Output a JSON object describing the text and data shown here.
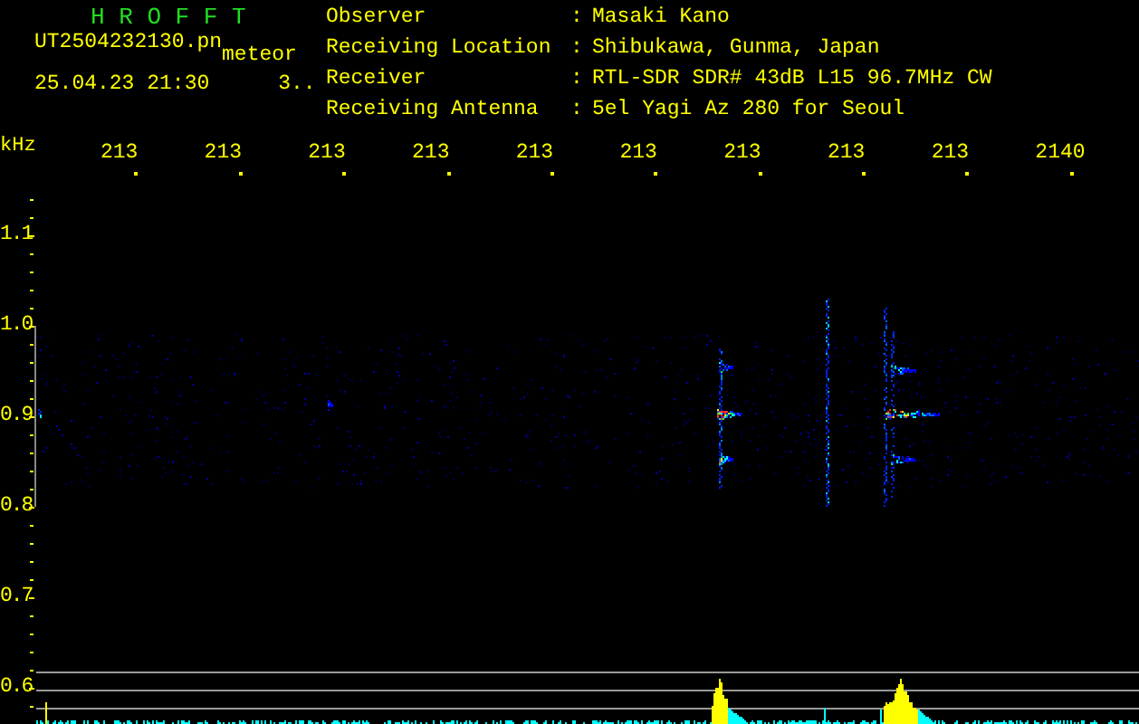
{
  "header": {
    "title": "H R O F F T",
    "filename": "UT2504232130.pn",
    "tag": "meteor",
    "datetime": "25.04.23 21:30",
    "count": "3..",
    "info": [
      {
        "label": "Observer",
        "separator": ":",
        "value": "Masaki Kano"
      },
      {
        "label": "Receiving Location",
        "separator": ":",
        "value": "Shibukawa, Gunma, Japan"
      },
      {
        "label": "Receiver",
        "separator": ":",
        "value": "RTL-SDR SDR# 43dB L15 96.7MHz CW"
      },
      {
        "label": "Receiving Antenna",
        "separator": ":",
        "value": "5el Yagi Az 280 for Seoul"
      }
    ]
  },
  "x_axis": {
    "unit": "kHz",
    "ticks": [
      "213",
      "213",
      "213",
      "213",
      "213",
      "213",
      "213",
      "213",
      "213",
      "2140"
    ]
  },
  "y_axis": {
    "ticks": [
      "1.1",
      "1.0",
      "0.9",
      "0.8",
      "0.7",
      "0.6"
    ]
  }
}
